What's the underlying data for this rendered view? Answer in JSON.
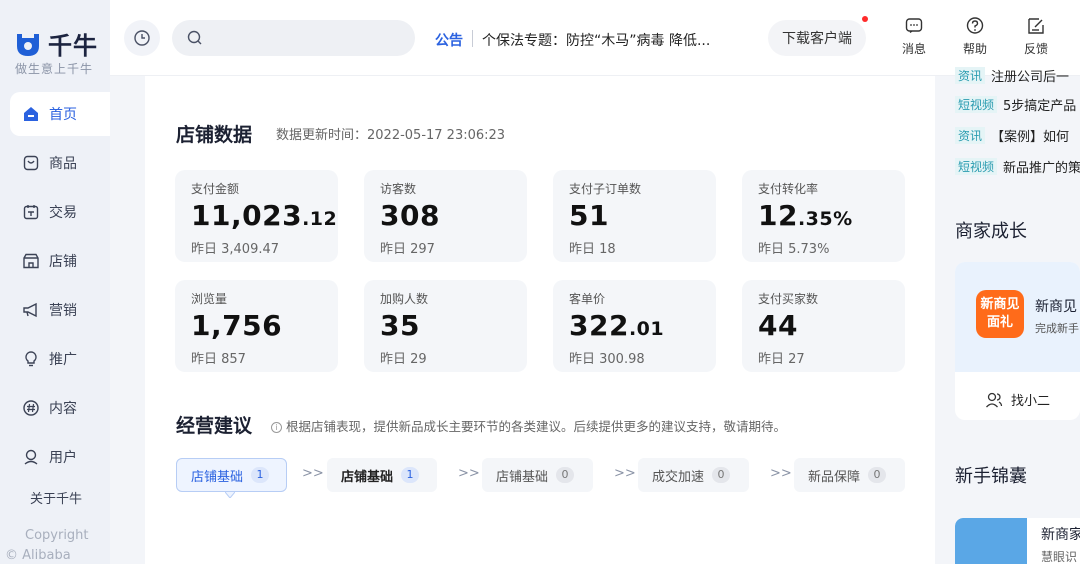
{
  "brand": {
    "name": "千牛",
    "slogan": "做生意上千牛"
  },
  "sidebar": {
    "items": [
      {
        "label": "首页",
        "icon": "home-icon"
      },
      {
        "label": "商品",
        "icon": "goods-icon"
      },
      {
        "label": "交易",
        "icon": "trade-icon"
      },
      {
        "label": "店铺",
        "icon": "store-icon"
      },
      {
        "label": "营销",
        "icon": "megaphone-icon"
      },
      {
        "label": "推广",
        "icon": "lightbulb-icon"
      },
      {
        "label": "内容",
        "icon": "hashtag-icon"
      },
      {
        "label": "用户",
        "icon": "user-icon"
      }
    ],
    "active_index": 0,
    "about": "关于千牛",
    "copyright_line1": "Copyright",
    "copyright_line2": "© Alibaba Group"
  },
  "topbar": {
    "search_placeholder": "",
    "notice_label": "公告",
    "notice_text": "个保法专题：防控“木马”病毒 降低...",
    "download_label": "下载客户端",
    "actions": [
      {
        "label": "消息",
        "icon": "message-icon"
      },
      {
        "label": "帮助",
        "icon": "help-icon"
      },
      {
        "label": "反馈",
        "icon": "feedback-icon"
      }
    ],
    "accent": "#2b62e0"
  },
  "store_data": {
    "title": "店铺数据",
    "updated_label": "数据更新时间：2022-05-17  23:06:23",
    "metrics": [
      {
        "label": "支付金额",
        "value_int": "11,023",
        "value_dec": ".12",
        "prev": "昨日 3,409.47"
      },
      {
        "label": "访客数",
        "value_int": "308",
        "value_dec": "",
        "prev": "昨日 297"
      },
      {
        "label": "支付子订单数",
        "value_int": "51",
        "value_dec": "",
        "prev": "昨日 18"
      },
      {
        "label": "支付转化率",
        "value_int": "12",
        "value_dec": ".35%",
        "prev": "昨日 5.73%"
      },
      {
        "label": "浏览量",
        "value_int": "1,756",
        "value_dec": "",
        "prev": "昨日 857"
      },
      {
        "label": "加购人数",
        "value_int": "35",
        "value_dec": "",
        "prev": "昨日 29"
      },
      {
        "label": "客单价",
        "value_int": "322",
        "value_dec": ".01",
        "prev": "昨日 300.98"
      },
      {
        "label": "支付买家数",
        "value_int": "44",
        "value_dec": "",
        "prev": "昨日 27"
      }
    ]
  },
  "advice": {
    "title": "经营建议",
    "hint": "根据店铺表现，提供新品成长主要环节的各类建议。后续提供更多的建议支持，敬请期待。",
    "steps": [
      {
        "label": "店铺基础",
        "count": "1"
      },
      {
        "label": "店铺基础",
        "count": "1"
      },
      {
        "label": "店铺基础",
        "count": "0"
      },
      {
        "label": "成交加速",
        "count": "0"
      },
      {
        "label": "新品保障",
        "count": "0"
      }
    ],
    "arrow": ">>"
  },
  "right": {
    "news": [
      {
        "tag": "资讯",
        "text": "注册公司后一"
      },
      {
        "tag": "短视频",
        "text": "5步搞定产品"
      },
      {
        "tag": "资讯",
        "text": "【案例】如何"
      },
      {
        "tag": "短视频",
        "text": "新品推广的策"
      }
    ],
    "growth_title": "商家成长",
    "growth_card": {
      "badge": "新商见面礼",
      "name": "新商见",
      "desc": "完成新手",
      "footer": "找小二"
    },
    "tips_title": "新手锦囊",
    "tip_card": {
      "name": "新商家",
      "desc": "慧眼识"
    }
  }
}
